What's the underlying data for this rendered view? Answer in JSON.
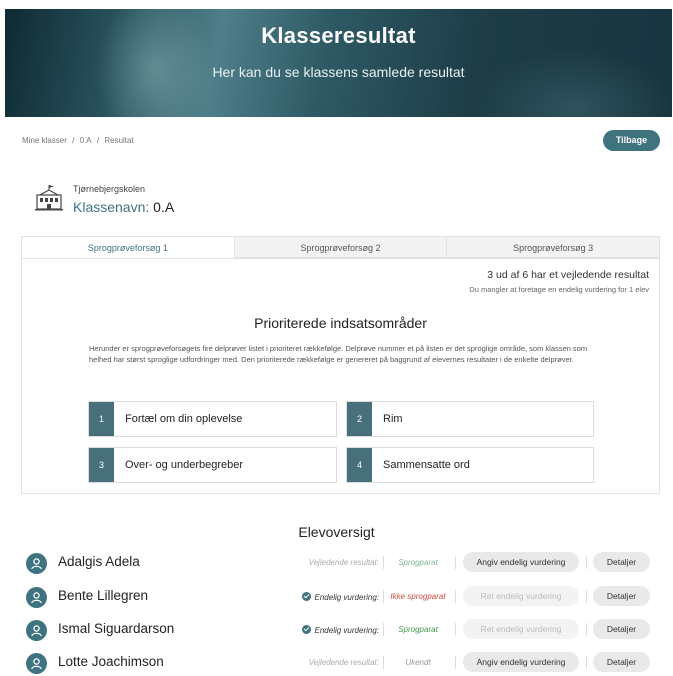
{
  "hero": {
    "title": "Klasseresultat",
    "subtitle": "Her kan du se klassens samlede resultat"
  },
  "breadcrumb": [
    "Mine klasser",
    "/",
    "0.A",
    "/",
    "Resultat"
  ],
  "back_label": "Tilbage",
  "school": {
    "icon": "school-building-icon",
    "name": "Tjørnebjergskolen",
    "class_label": "Klassenavn:",
    "class_value": "0.A"
  },
  "tabs": [
    "Sprogprøveforsøg 1",
    "Sprogprøveforsøg 2",
    "Sprogprøveforsøg 3"
  ],
  "active_tab": 0,
  "summary": {
    "main": "3 ud af 6 har et vejledende resultat",
    "sub": "Du mangler at foretage en endelig vurdering for 1 elev"
  },
  "priority": {
    "title": "Prioriterede indsatsområder",
    "description": "Herunder er sprogprøveforsøgets fire delprøver listet i prioriteret rækkefølge. Delprøve nummer et på listen er det sproglige område, som klassen som helhed har størst sproglige udfordringer med. Den prioriterede rækkefølge er genereret på baggrund af elevernes resultater i de enkelte delprøver.",
    "areas": [
      {
        "num": "1",
        "label": "Fortæl om din oplevelse"
      },
      {
        "num": "2",
        "label": "Rim"
      },
      {
        "num": "3",
        "label": "Over- og underbegreber"
      },
      {
        "num": "4",
        "label": "Sammensatte ord"
      }
    ]
  },
  "students_title": "Elevoversigt",
  "students": [
    {
      "name": "Adalgis Adela",
      "label": "Vejledende resultat:",
      "final": false,
      "status": "Sprogparat",
      "status_color": "#7fb89a",
      "vurd_label": "Angiv endelig vurdering",
      "vurd_enabled": true,
      "details_label": "Detaljer"
    },
    {
      "name": "Bente Lillegren",
      "label": "Endelig vurdering:",
      "final": true,
      "status": "Ikke sprogparat",
      "status_color": "#d0493b",
      "vurd_label": "Ret endelig vurdering",
      "vurd_enabled": false,
      "details_label": "Detaljer"
    },
    {
      "name": "Ismal Siguardarson",
      "label": "Endelig vurdering:",
      "final": true,
      "status": "Sprogparat",
      "status_color": "#3f9a4a",
      "vurd_label": "Ret endelig vurdering",
      "vurd_enabled": false,
      "details_label": "Detaljer"
    },
    {
      "name": "Lotte Joachimson",
      "label": "Vejledende resultat:",
      "final": false,
      "status": "Ukendt",
      "status_color": "#999999",
      "vurd_label": "Angiv endelig vurdering",
      "vurd_enabled": true,
      "details_label": "Detaljer"
    }
  ],
  "colors": {
    "accent": "#3f7380",
    "number_badge": "#47707b"
  }
}
